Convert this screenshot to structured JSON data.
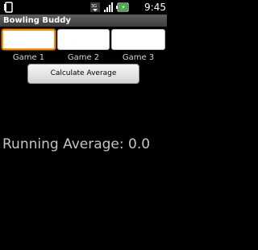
{
  "status_bar": {
    "time": "9:45 PM",
    "icons": [
      "notification-icon",
      "network-icon",
      "signal-icon",
      "battery-icon"
    ],
    "battery_color": "#3bb53b"
  },
  "app": {
    "title": "Bowling Buddy"
  },
  "games": [
    {
      "label": "Game 1",
      "value": "",
      "focused": true
    },
    {
      "label": "Game 2",
      "value": ""
    },
    {
      "label": "Game 3",
      "value": ""
    }
  ],
  "calculate_button": {
    "label": "Calculate Average"
  },
  "running_average": {
    "text": "Running Average: 0.0"
  },
  "colors": {
    "focus_accent": "#ff8a00",
    "background": "#000000"
  }
}
